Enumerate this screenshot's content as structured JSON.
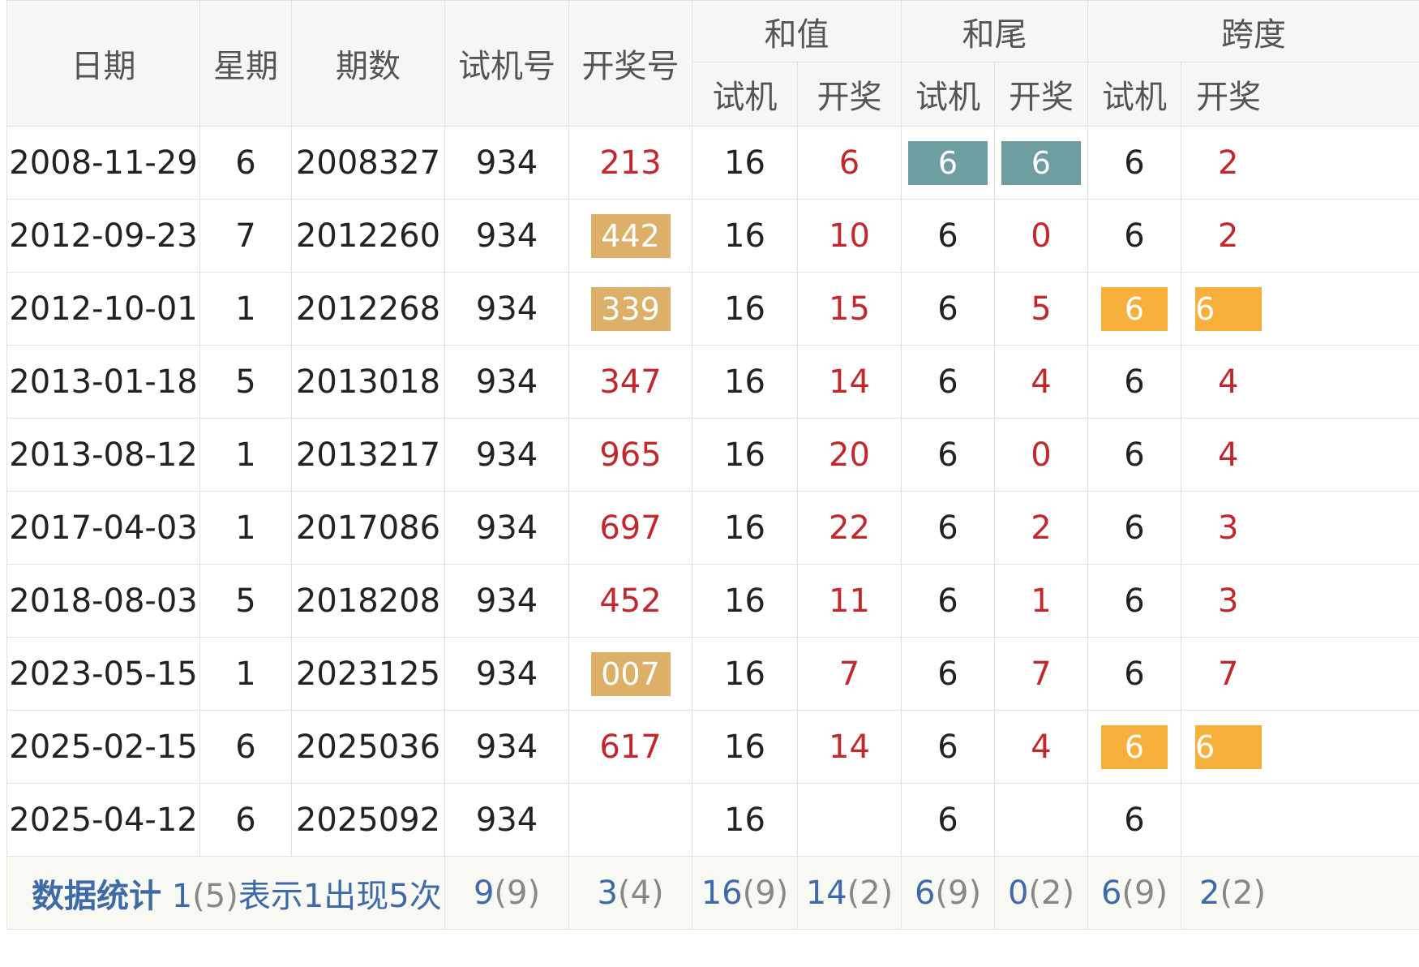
{
  "header": {
    "date": "日期",
    "weekday": "星期",
    "issue": "期数",
    "test_number": "试机号",
    "draw_number": "开奖号",
    "group_sum": "和值",
    "group_tail": "和尾",
    "group_span": "跨度",
    "sub_test": "试机",
    "sub_draw": "开奖"
  },
  "colors": {
    "teal_badge": "#6e9ea0",
    "tan_badge": "#ddb06a",
    "orange_badge": "#f7b03c",
    "red_text": "#c0282d",
    "stat_blue": "#3e6aa8"
  },
  "rows": [
    {
      "date": "2008-11-29",
      "weekday": "6",
      "issue": "2008327",
      "test": "934",
      "draw": "213",
      "sum_test": "16",
      "sum_draw": "6",
      "tail_test": "6",
      "tail_draw": "6",
      "span_test": "6",
      "span_draw": "2"
    },
    {
      "date": "2012-09-23",
      "weekday": "7",
      "issue": "2012260",
      "test": "934",
      "draw": "442",
      "sum_test": "16",
      "sum_draw": "10",
      "tail_test": "6",
      "tail_draw": "0",
      "span_test": "6",
      "span_draw": "2"
    },
    {
      "date": "2012-10-01",
      "weekday": "1",
      "issue": "2012268",
      "test": "934",
      "draw": "339",
      "sum_test": "16",
      "sum_draw": "15",
      "tail_test": "6",
      "tail_draw": "5",
      "span_test": "6",
      "span_draw": "6"
    },
    {
      "date": "2013-01-18",
      "weekday": "5",
      "issue": "2013018",
      "test": "934",
      "draw": "347",
      "sum_test": "16",
      "sum_draw": "14",
      "tail_test": "6",
      "tail_draw": "4",
      "span_test": "6",
      "span_draw": "4"
    },
    {
      "date": "2013-08-12",
      "weekday": "1",
      "issue": "2013217",
      "test": "934",
      "draw": "965",
      "sum_test": "16",
      "sum_draw": "20",
      "tail_test": "6",
      "tail_draw": "0",
      "span_test": "6",
      "span_draw": "4"
    },
    {
      "date": "2017-04-03",
      "weekday": "1",
      "issue": "2017086",
      "test": "934",
      "draw": "697",
      "sum_test": "16",
      "sum_draw": "22",
      "tail_test": "6",
      "tail_draw": "2",
      "span_test": "6",
      "span_draw": "3"
    },
    {
      "date": "2018-08-03",
      "weekday": "5",
      "issue": "2018208",
      "test": "934",
      "draw": "452",
      "sum_test": "16",
      "sum_draw": "11",
      "tail_test": "6",
      "tail_draw": "1",
      "span_test": "6",
      "span_draw": "3"
    },
    {
      "date": "2023-05-15",
      "weekday": "1",
      "issue": "2023125",
      "test": "934",
      "draw": "007",
      "sum_test": "16",
      "sum_draw": "7",
      "tail_test": "6",
      "tail_draw": "7",
      "span_test": "6",
      "span_draw": "7"
    },
    {
      "date": "2025-02-15",
      "weekday": "6",
      "issue": "2025036",
      "test": "934",
      "draw": "617",
      "sum_test": "16",
      "sum_draw": "14",
      "tail_test": "6",
      "tail_draw": "4",
      "span_test": "6",
      "span_draw": "6"
    },
    {
      "date": "2025-04-12",
      "weekday": "6",
      "issue": "2025092",
      "test": "934",
      "draw": "",
      "sum_test": "16",
      "sum_draw": "",
      "tail_test": "6",
      "tail_draw": "",
      "span_test": "6",
      "span_draw": ""
    }
  ],
  "stats": {
    "title": "数据统计",
    "desc_num": "1",
    "desc_paren": "(5)",
    "desc_text": "表示1出现5次",
    "test": {
      "num": "9",
      "count": "(9)"
    },
    "draw": {
      "num": "3",
      "count": "(4)"
    },
    "sum_test": {
      "num": "16",
      "count": "(9)"
    },
    "sum_draw": {
      "num": "14",
      "count": "(2)"
    },
    "tail_test": {
      "num": "6",
      "count": "(9)"
    },
    "tail_draw": {
      "num": "0",
      "count": "(2)"
    },
    "span_test": {
      "num": "6",
      "count": "(9)"
    },
    "span_draw": {
      "num": "2",
      "count": "(2)"
    }
  }
}
